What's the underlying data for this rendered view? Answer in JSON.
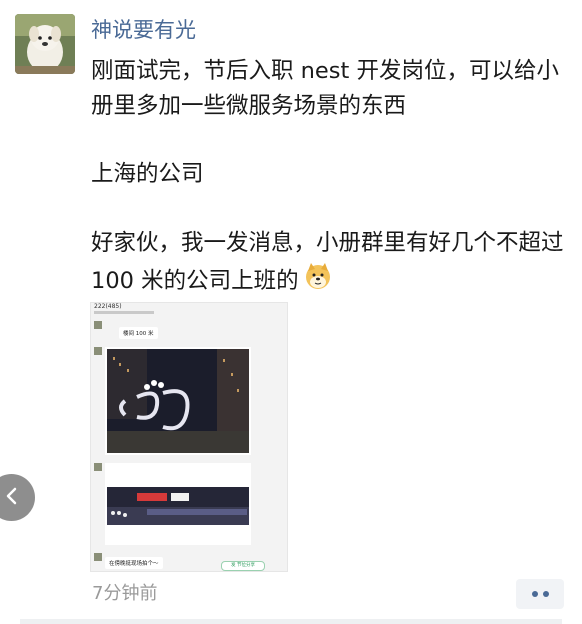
{
  "post": {
    "author": "神说要有光",
    "paragraphs": [
      "刚面试完，节后入职 nest 开发岗位，可以给小册里多加一些微服务场景的东西",
      "上海的公司",
      "好家伙，我一发消息，小册群里有好几个不超过 100 米的公司上班的"
    ],
    "emoji_icon": "doge-emoji-icon",
    "timestamp": "7分钟前"
  },
  "screenshot": {
    "group_title": "222(485)",
    "bubbles": {
      "first": "楼间 100 米",
      "last": "在傍晚挺现场拍个～"
    },
    "button_label": "发 节位分享",
    "photo1_alt": "night cityscape with large logo sculpture",
    "photo2_alt": "building sign at night"
  },
  "controls": {
    "back_icon": "chevron-left-icon",
    "more_icon": "more-dots-icon"
  },
  "colors": {
    "author_name": "#4a6a96",
    "timestamp": "#9a9a9a",
    "back_button": "#8e8e8e"
  }
}
